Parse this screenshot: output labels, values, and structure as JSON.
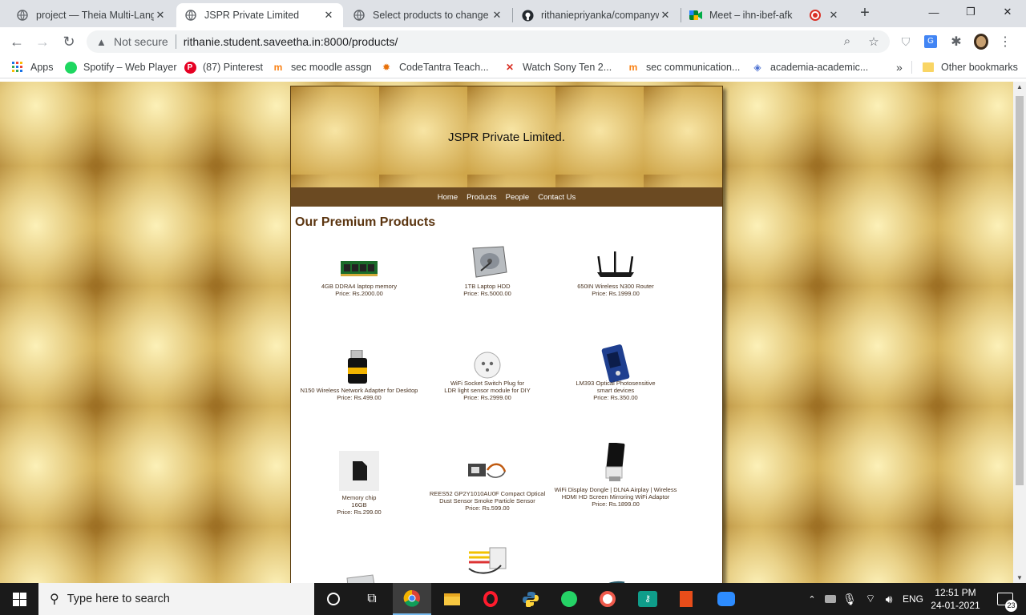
{
  "browser": {
    "tabs": [
      {
        "title": "project — Theia Multi-Lang",
        "icon": "globe-icon",
        "active": false
      },
      {
        "title": "JSPR Private Limited",
        "icon": "globe-icon",
        "active": true
      },
      {
        "title": "Select products to change |",
        "icon": "globe-icon",
        "active": false
      },
      {
        "title": "rithaniepriyanka/companyw",
        "icon": "github-icon",
        "active": false
      },
      {
        "title": "Meet – ihn-ibef-afk",
        "icon": "meet-icon",
        "active": false
      }
    ],
    "new_tab": "+",
    "window_controls": {
      "minimize": "—",
      "restore": "❐",
      "close": "✕"
    },
    "security_label": "Not secure",
    "url": "rithanie.student.saveetha.in:8000/products/",
    "bookmarks": [
      {
        "label": "Apps",
        "icon": "apps-grid-icon"
      },
      {
        "label": "Spotify – Web Player",
        "icon": "spotify-icon"
      },
      {
        "label": "(87) Pinterest",
        "icon": "pinterest-icon"
      },
      {
        "label": "sec moodle assgn",
        "icon": "moodle-icon"
      },
      {
        "label": "CodeTantra Teach...",
        "icon": "codetantra-icon"
      },
      {
        "label": "Watch Sony Ten 2...",
        "icon": "sony-icon"
      },
      {
        "label": "sec communication...",
        "icon": "moodle-icon"
      },
      {
        "label": "academia-academic...",
        "icon": "academia-icon"
      }
    ],
    "bookmarks_overflow": "»",
    "other_bookmarks": "Other bookmarks"
  },
  "site": {
    "company": "JSPR Private Limited.",
    "nav": [
      "Home",
      "Products",
      "People",
      "Contact Us"
    ],
    "heading": "Our Premium Products",
    "products": [
      {
        "name": "4GB DDRA4 laptop memory",
        "price": "Price: Rs.2000.00",
        "icon": "ram-stick-icon"
      },
      {
        "name": "1TB Laptop HDD",
        "price": "Price: Rs.5000.00",
        "icon": "hard-drive-icon"
      },
      {
        "name": "650IN Wireless N300 Router",
        "price": "Price: Rs.1999.00",
        "icon": "router-icon"
      },
      {
        "name": "N150 Wireless Network Adapter for Desktop",
        "price": "Price: Rs.499.00",
        "icon": "usb-wifi-adapter-icon"
      },
      {
        "name": "WiFi Socket Switch Plug for\nLDR light sensor module for DIY",
        "price": "Price: Rs.2999.00",
        "icon": "smart-plug-icon"
      },
      {
        "name": "LM393 Optical Photosensitive\nsmart devices",
        "price": "Price: Rs.350.00",
        "icon": "sensor-module-icon"
      },
      {
        "name": "Memory chip\n16GB",
        "price": "Price: Rs.299.00",
        "icon": "sd-card-icon"
      },
      {
        "name": "REES52 GP2Y1010AU0F Compact Optical\nDust Sensor Smoke Particle Sensor",
        "price": "Price: Rs.599.00",
        "icon": "dust-sensor-icon"
      },
      {
        "name": "WiFi Display Dongle | DLNA Airplay | Wireless\nHDMI HD Screen Mirroring WiFi Adaptor",
        "price": "Price: Rs.1899.00",
        "icon": "hdmi-dongle-icon"
      }
    ]
  },
  "taskbar": {
    "search_placeholder": "Type here to search",
    "language": "ENG",
    "time": "12:51 PM",
    "date": "24-01-2021",
    "notification_count": "23"
  }
}
